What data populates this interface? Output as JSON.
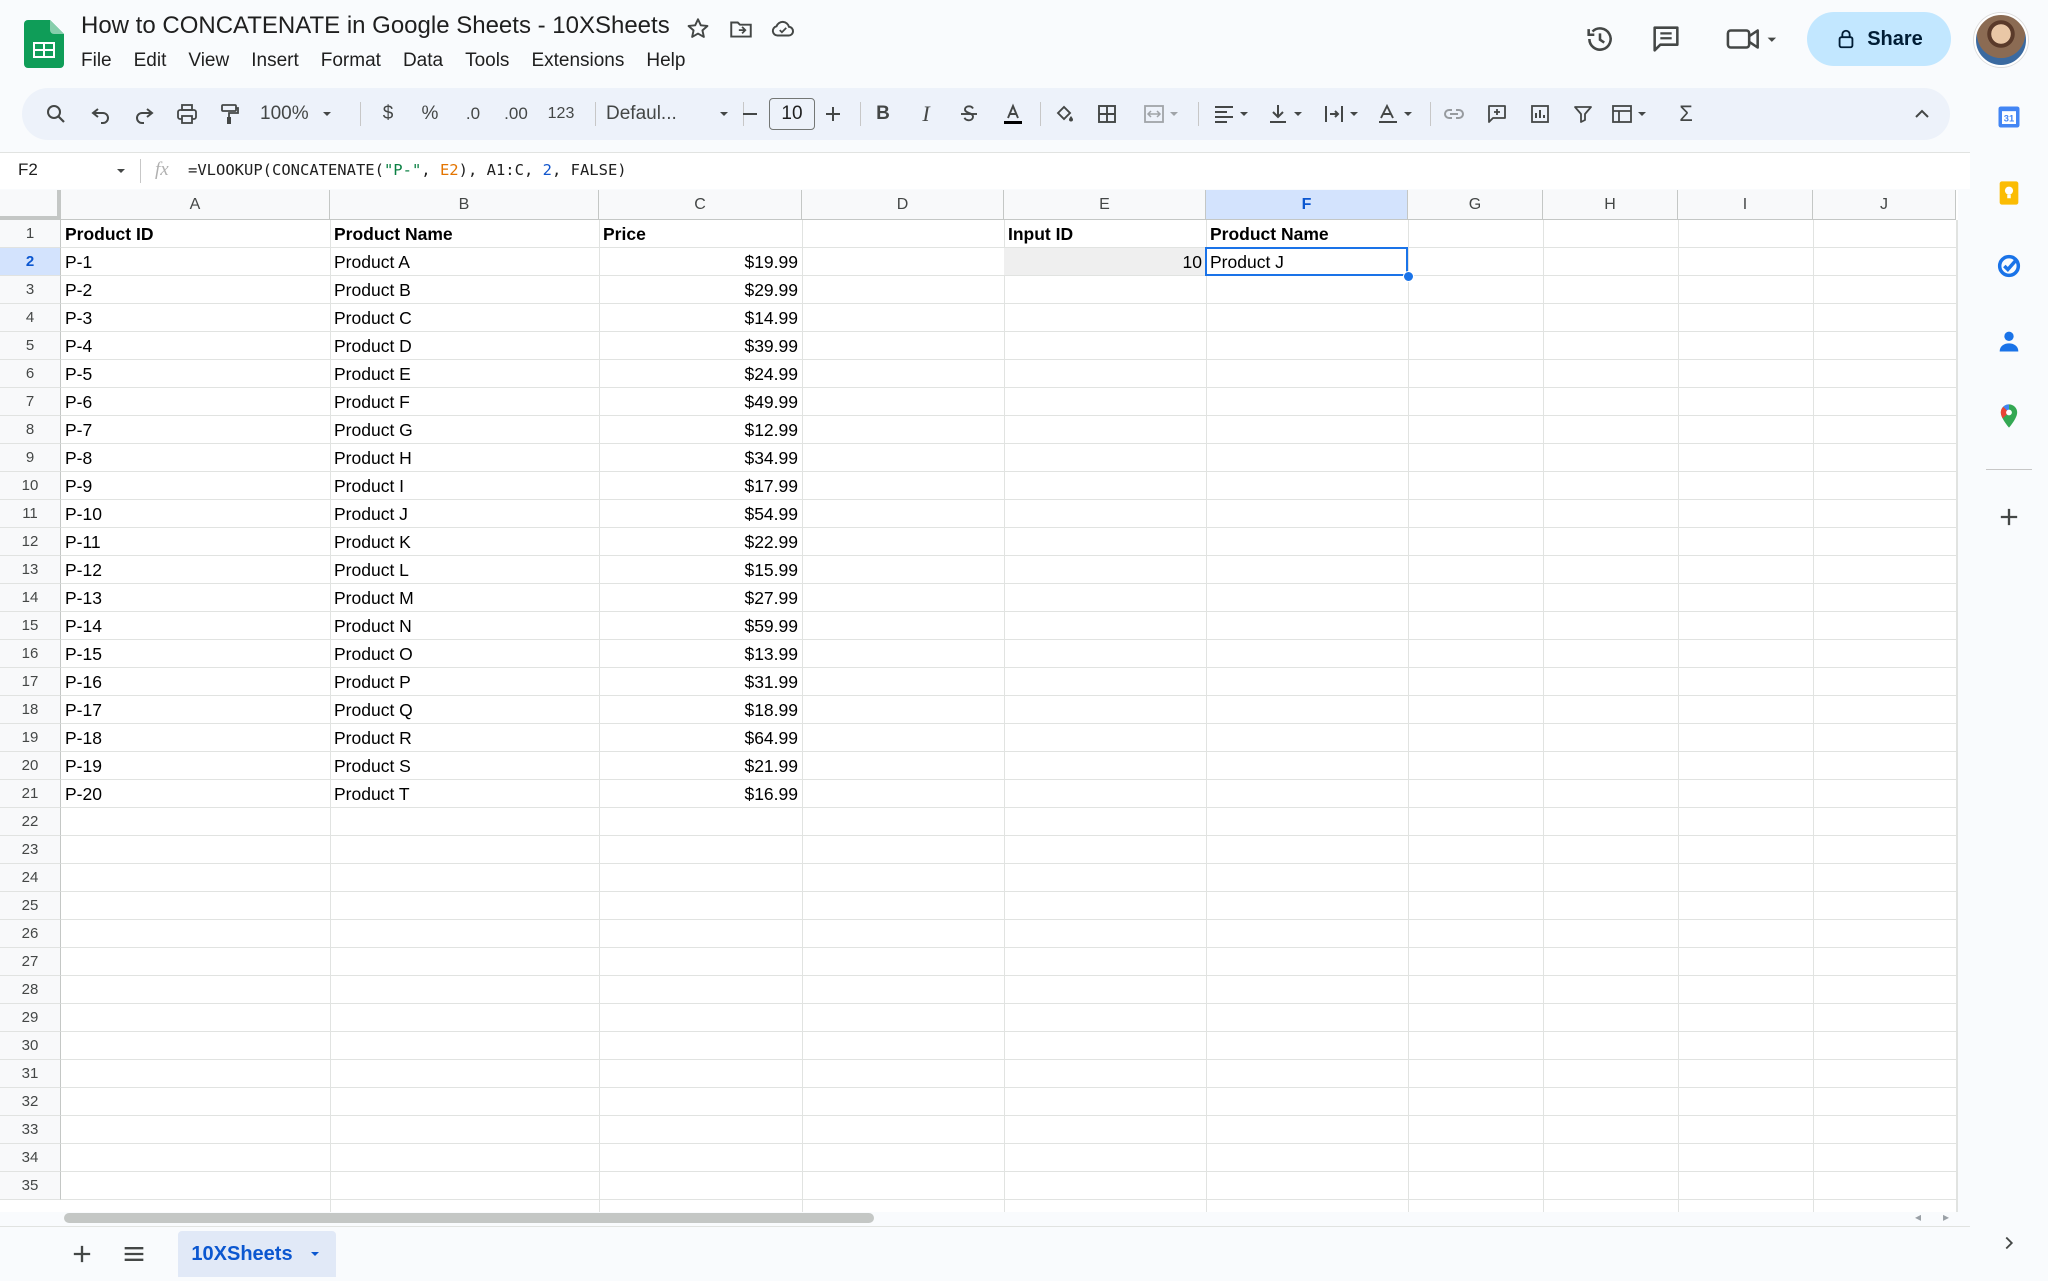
{
  "app": {
    "title": "How to CONCATENATE in Google Sheets - 10XSheets",
    "menu": [
      "File",
      "Edit",
      "View",
      "Insert",
      "Format",
      "Data",
      "Tools",
      "Extensions",
      "Help"
    ],
    "share_label": "Share"
  },
  "toolbar": {
    "zoom": "100%",
    "currency": "$",
    "percent": "%",
    "dec_decrease": ".0",
    "dec_increase": ".00",
    "number_format": "123",
    "font": "Defaul...",
    "font_size": "10",
    "bold": "B",
    "italic": "I",
    "functions": "Σ"
  },
  "formula_bar": {
    "name_box": "F2",
    "fx": "fx",
    "formula_parts": [
      "=VLOOKUP(CONCATENATE(",
      "\"P-\"",
      ", ",
      "E2",
      "), A1:C, ",
      "2",
      ", FALSE)"
    ]
  },
  "grid": {
    "columns": [
      "A",
      "B",
      "C",
      "D",
      "E",
      "F",
      "G",
      "H",
      "I",
      "J"
    ],
    "selected_column": "F",
    "selected_cell": "F2",
    "selected_row": 2,
    "row_numbers": [
      "1",
      "2",
      "3",
      "4",
      "5",
      "6",
      "7",
      "8",
      "9",
      "10",
      "11",
      "12",
      "13",
      "14",
      "15",
      "16",
      "17",
      "18",
      "19",
      "20",
      "21",
      "22",
      "23",
      "24",
      "25",
      "26",
      "27",
      "28",
      "29",
      "30",
      "31",
      "32",
      "33",
      "34",
      "35"
    ],
    "headers": {
      "A": "Product ID",
      "B": "Product Name",
      "C": "Price",
      "E": "Input ID",
      "F": "Product Name"
    },
    "rows": [
      [
        "P-1",
        "Product A",
        "$19.99"
      ],
      [
        "P-2",
        "Product B",
        "$29.99"
      ],
      [
        "P-3",
        "Product C",
        "$14.99"
      ],
      [
        "P-4",
        "Product D",
        "$39.99"
      ],
      [
        "P-5",
        "Product E",
        "$24.99"
      ],
      [
        "P-6",
        "Product F",
        "$49.99"
      ],
      [
        "P-7",
        "Product G",
        "$12.99"
      ],
      [
        "P-8",
        "Product H",
        "$34.99"
      ],
      [
        "P-9",
        "Product I",
        "$17.99"
      ],
      [
        "P-10",
        "Product J",
        "$54.99"
      ],
      [
        "P-11",
        "Product K",
        "$22.99"
      ],
      [
        "P-12",
        "Product L",
        "$15.99"
      ],
      [
        "P-13",
        "Product M",
        "$27.99"
      ],
      [
        "P-14",
        "Product N",
        "$59.99"
      ],
      [
        "P-15",
        "Product O",
        "$13.99"
      ],
      [
        "P-16",
        "Product P",
        "$31.99"
      ],
      [
        "P-17",
        "Product Q",
        "$18.99"
      ],
      [
        "P-18",
        "Product R",
        "$64.99"
      ],
      [
        "P-19",
        "Product S",
        "$21.99"
      ],
      [
        "P-20",
        "Product T",
        "$16.99"
      ]
    ],
    "input_id": "10",
    "result": "Product J"
  },
  "sheet_tabs": [
    {
      "label": "10XSheets",
      "active": true
    }
  ],
  "icons": {
    "header": [
      "star-icon",
      "move-to-folder-icon",
      "cloud-status-icon",
      "version-history-icon",
      "comments-icon",
      "meet-icon",
      "lock-icon"
    ],
    "side_panel": [
      "calendar-icon",
      "keep-icon",
      "tasks-icon",
      "contacts-icon",
      "maps-icon",
      "add-on-icon"
    ]
  },
  "colors": {
    "accent": "#0b57d0",
    "share_bg": "#c2e7ff",
    "selection": "#1a73e8",
    "sheets_green": "#0f9d58"
  }
}
